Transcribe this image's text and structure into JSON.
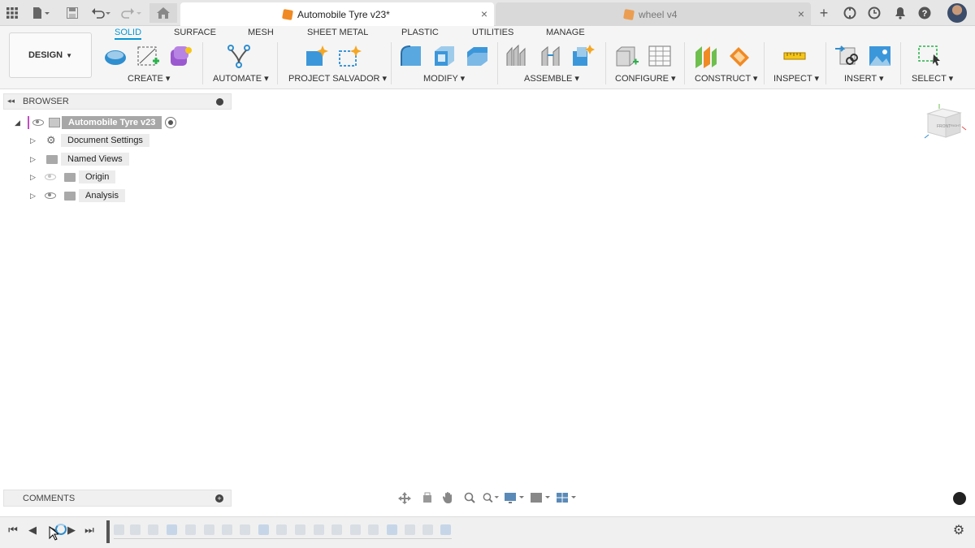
{
  "app": {
    "tabs": [
      {
        "label": "Automobile Tyre v23*",
        "active": true
      },
      {
        "label": "wheel v4",
        "active": false
      }
    ]
  },
  "toolbar": {
    "design_label": "DESIGN",
    "workspace_tabs": [
      "SOLID",
      "SURFACE",
      "MESH",
      "SHEET METAL",
      "PLASTIC",
      "UTILITIES",
      "MANAGE"
    ],
    "active_tab": "SOLID",
    "groups": [
      "CREATE",
      "AUTOMATE",
      "PROJECT SALVADOR",
      "MODIFY",
      "ASSEMBLE",
      "CONFIGURE",
      "CONSTRUCT",
      "INSPECT",
      "INSERT",
      "SELECT"
    ]
  },
  "browser": {
    "title": "BROWSER",
    "root": "Automobile Tyre v23",
    "items": [
      "Document Settings",
      "Named Views",
      "Origin",
      "Analysis"
    ]
  },
  "comments": {
    "title": "COMMENTS"
  },
  "viewcube": {
    "face_label": "FRONT",
    "side_label": "RIGHT"
  },
  "colors": {
    "accent": "#0696d7",
    "tab_cube": "#f08a24"
  },
  "icons": [
    "apps-grid-icon",
    "file-icon",
    "save-icon",
    "undo-icon",
    "redo-icon",
    "home-icon",
    "new-tab-icon",
    "extensions-icon",
    "history-icon",
    "notifications-icon",
    "help-icon",
    "settings-gear-icon"
  ]
}
